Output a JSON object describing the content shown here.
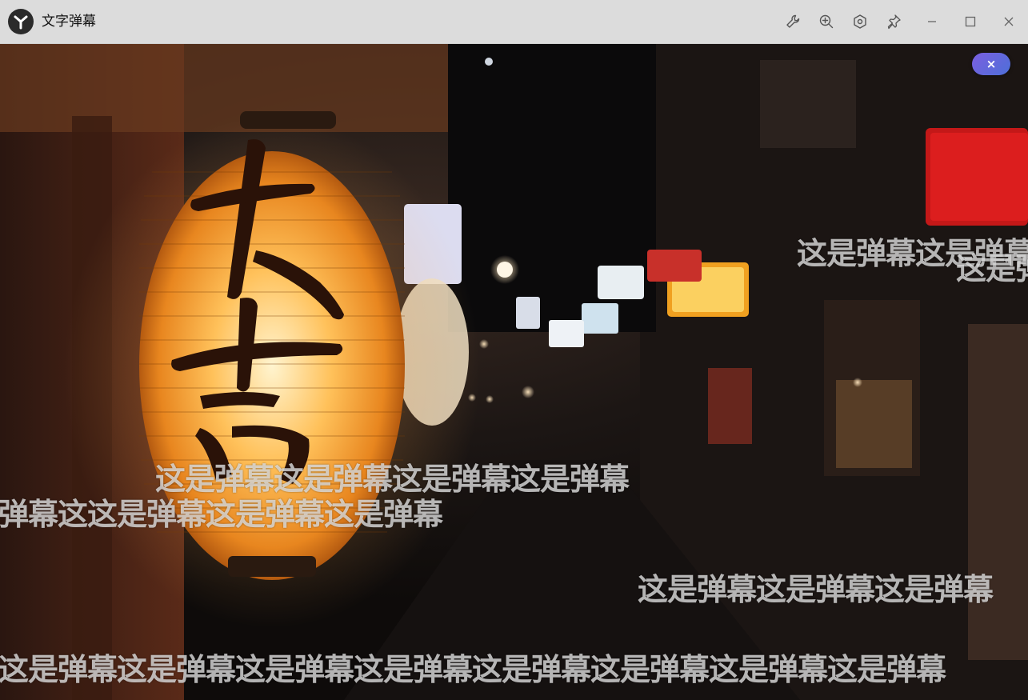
{
  "window": {
    "title": "文字弹幕",
    "icons": [
      "app-logo-icon",
      "wrench-icon",
      "zoom-in-icon",
      "hex-settings-icon",
      "pin-icon",
      "minimize-icon",
      "maximize-icon",
      "close-icon"
    ]
  },
  "overlay": {
    "close_label": "×"
  },
  "danmu": [
    "这是弹幕这是弹幕",
    "这是弹",
    "这是弹幕这是弹幕这是弹幕这是弹幕",
    "弹幕这这是弹幕这是弹幕这是弹幕",
    "这是弹幕这是弹幕这是弹幕",
    "这是弹幕这是弹幕这是弹幕这是弹幕这是弹幕这是弹幕这是弹幕这是弹幕"
  ],
  "colors": {
    "titlebar": "#dcdcdc",
    "accent_start": "#7b5fe0",
    "accent_end": "#4d6fd8"
  }
}
